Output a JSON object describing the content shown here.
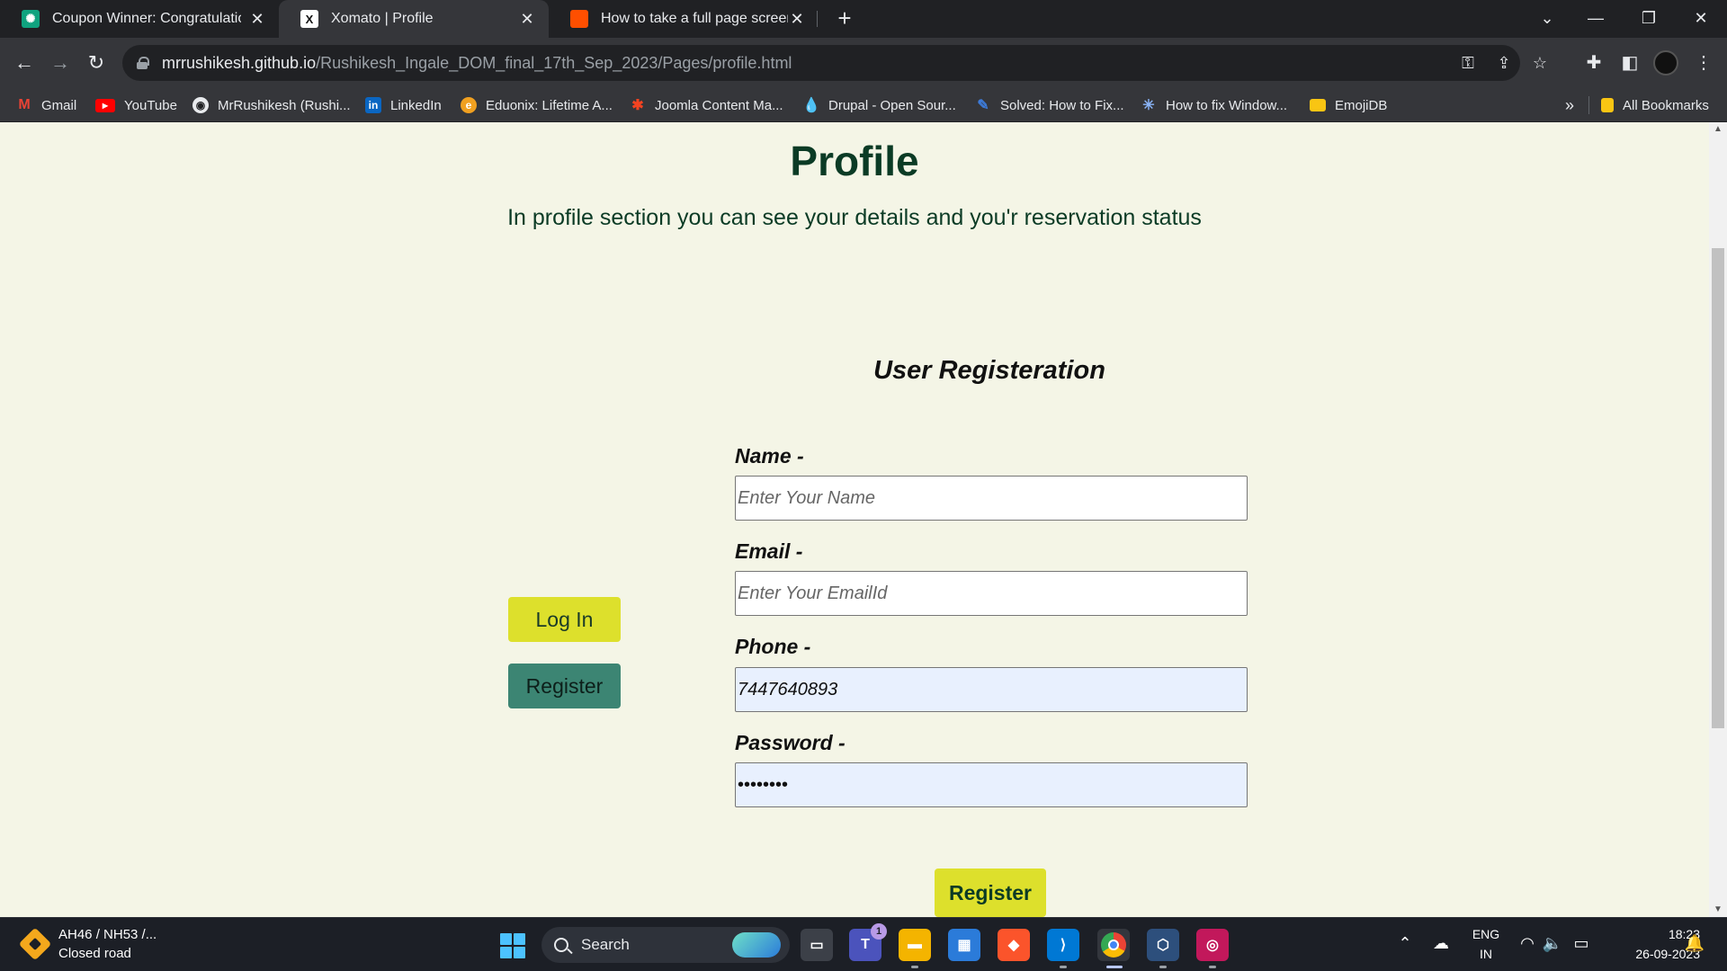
{
  "browser": {
    "tabs": [
      {
        "title": "Coupon Winner: Congratulations",
        "active": false,
        "favicon": "openai-icon"
      },
      {
        "title": "Xomato | Profile",
        "active": true,
        "favicon": "x-icon"
      },
      {
        "title": "How to take a full page screensh",
        "active": false,
        "favicon": "orange-square-icon"
      }
    ],
    "url_host": "mrrushikesh.github.io",
    "url_path": "/Rushikesh_Ingale_DOM_final_17th_Sep_2023/Pages/profile.html",
    "bookmarks": [
      {
        "label": "Gmail",
        "icon": "gmail-icon",
        "color": "#ea4335"
      },
      {
        "label": "YouTube",
        "icon": "youtube-icon",
        "color": "#ff0000"
      },
      {
        "label": "MrRushikesh (Rushi...",
        "icon": "github-icon",
        "color": "#e8eaed"
      },
      {
        "label": "LinkedIn",
        "icon": "linkedin-icon",
        "color": "#0a66c2"
      },
      {
        "label": "Eduonix: Lifetime A...",
        "icon": "eduonix-icon",
        "color": "#f0a020"
      },
      {
        "label": "Joomla Content Ma...",
        "icon": "joomla-icon",
        "color": "#f44321"
      },
      {
        "label": "Drupal - Open Sour...",
        "icon": "drupal-icon",
        "color": "#0678be"
      },
      {
        "label": "Solved: How to Fix...",
        "icon": "solved-icon",
        "color": "#3d7bd9"
      },
      {
        "label": "How to fix Window...",
        "icon": "sparkle-icon",
        "color": "#8ab4f8"
      },
      {
        "label": "EmojiDB",
        "icon": "folder-icon",
        "color": "#f9c513"
      }
    ],
    "overflow_label": "»",
    "all_bookmarks_label": "All Bookmarks"
  },
  "page": {
    "title": "Profile",
    "subtitle": "In profile section you can see your details and you'r reservation status",
    "registration_title": "User Registeration",
    "fields": {
      "name": {
        "label": "Name -",
        "placeholder": "Enter Your Name",
        "value": ""
      },
      "email": {
        "label": "Email -",
        "placeholder": "Enter Your EmailId",
        "value": ""
      },
      "phone": {
        "label": "Phone -",
        "placeholder": "",
        "value": "7447640893"
      },
      "password": {
        "label": "Password -",
        "placeholder": "",
        "value": "••••••••"
      }
    },
    "login_button": "Log In",
    "register_side_button": "Register",
    "register_submit_button": "Register",
    "colors": {
      "background": "#f4f5e6",
      "heading": "#0b3b25",
      "login_button": "#dde02c",
      "register_side_button": "#3c8573",
      "autofill_input": "#e8f0fe"
    }
  },
  "taskbar": {
    "traffic_line1": "AH46 / NH53 /...",
    "traffic_line2": "Closed road",
    "search_label": "Search",
    "teams_badge": "1",
    "lang_line1": "ENG",
    "lang_line2": "IN",
    "time": "18:23",
    "date": "26-09-2023"
  }
}
